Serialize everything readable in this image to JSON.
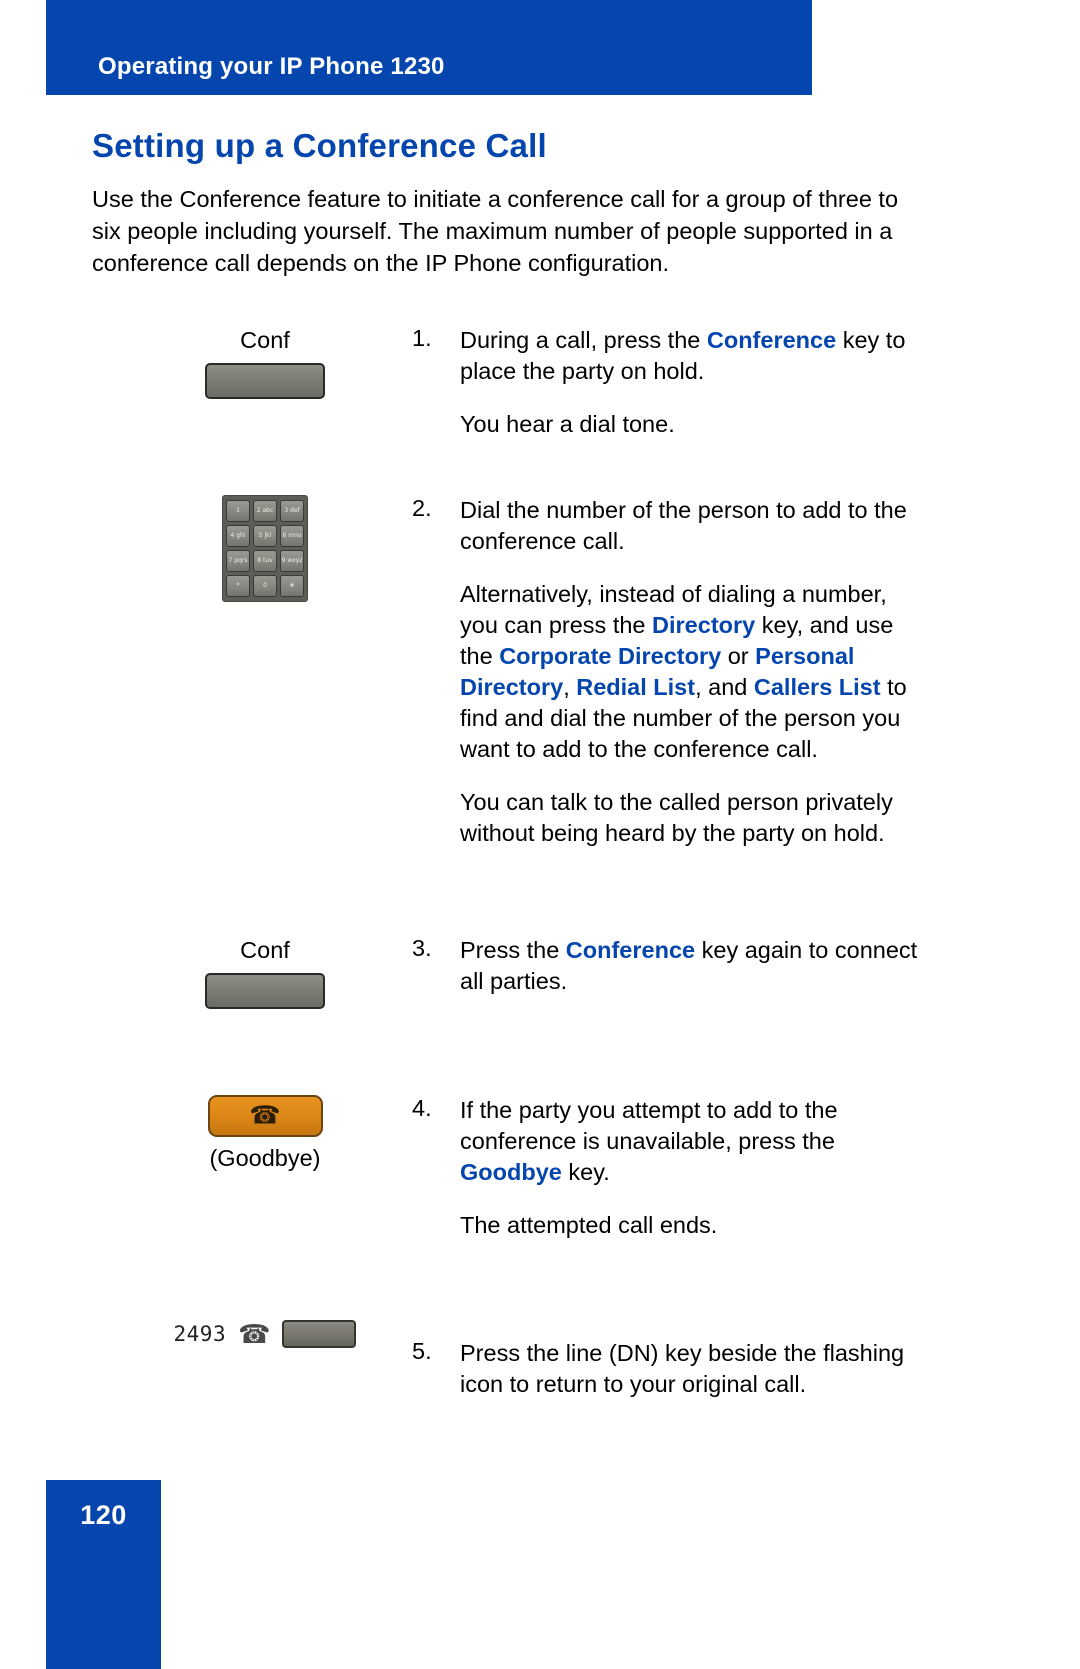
{
  "header": {
    "title": "Operating your IP Phone 1230",
    "bar_color": "#0546ae"
  },
  "page_title": "Setting up a Conference Call",
  "intro": "Use the Conference feature to initiate a conference call for a group of three to six people including yourself. The maximum number of people supported in a conference call depends on the IP Phone configuration.",
  "steps": [
    {
      "number": "1.",
      "art_label": "Conf",
      "art_type": "soft-key",
      "paragraphs": [
        {
          "runs": [
            {
              "text": "During a call, press the ",
              "style": "normal"
            },
            {
              "text": "Conference",
              "style": "keyword"
            },
            {
              "text": " key to place the party on hold.",
              "style": "normal"
            }
          ]
        },
        {
          "runs": [
            {
              "text": "You hear a dial tone.",
              "style": "normal"
            }
          ]
        }
      ]
    },
    {
      "number": "2.",
      "art_label": "",
      "art_type": "keypad",
      "keypad_keys": [
        "1",
        "2 abc",
        "3 def",
        "4 ghi",
        "5 jkl",
        "6 mno",
        "7 pqrs",
        "8 tuv",
        "9 wxyz",
        "*",
        "0",
        "#"
      ],
      "paragraphs": [
        {
          "runs": [
            {
              "text": "Dial the number of the person to add to the conference call.",
              "style": "normal"
            }
          ]
        },
        {
          "runs": [
            {
              "text": "Alternatively, instead of dialing a number, you can press the ",
              "style": "normal"
            },
            {
              "text": "Directory",
              "style": "keyword"
            },
            {
              "text": " key, and use the ",
              "style": "normal"
            },
            {
              "text": "Corporate Directory",
              "style": "keyword"
            },
            {
              "text": " or ",
              "style": "normal"
            },
            {
              "text": "Personal Directory",
              "style": "keyword"
            },
            {
              "text": ", ",
              "style": "normal"
            },
            {
              "text": "Redial List",
              "style": "keyword"
            },
            {
              "text": ", and ",
              "style": "normal"
            },
            {
              "text": "Callers List",
              "style": "keyword"
            },
            {
              "text": " to find and dial the number of the person you want to add to the conference call.",
              "style": "normal"
            }
          ]
        },
        {
          "runs": [
            {
              "text": "You can talk to the called person privately without being heard by the party on hold.",
              "style": "normal"
            }
          ]
        }
      ]
    },
    {
      "number": "3.",
      "art_label": "Conf",
      "art_type": "soft-key",
      "paragraphs": [
        {
          "runs": [
            {
              "text": "Press the ",
              "style": "normal"
            },
            {
              "text": "Conference",
              "style": "keyword"
            },
            {
              "text": " key again to connect all parties.",
              "style": "normal"
            }
          ]
        }
      ]
    },
    {
      "number": "4.",
      "art_label": "",
      "art_type": "goodbye-key",
      "art_caption": "(Goodbye)",
      "paragraphs": [
        {
          "runs": [
            {
              "text": "If the party you attempt to add to the conference is unavailable, press the ",
              "style": "normal"
            },
            {
              "text": "Goodbye",
              "style": "keyword"
            },
            {
              "text": " key.",
              "style": "normal"
            }
          ]
        },
        {
          "runs": [
            {
              "text": "The attempted call ends.",
              "style": "normal"
            }
          ]
        }
      ]
    },
    {
      "number": "5.",
      "art_label": "",
      "art_type": "line-key",
      "dn_number": "2493",
      "paragraphs": [
        {
          "runs": [
            {
              "text": "Press the line (DN) key beside the flashing icon to return to your original call.",
              "style": "normal"
            }
          ]
        }
      ]
    }
  ],
  "footer": {
    "page_number": "120",
    "bar_color": "#0546ae"
  },
  "colors": {
    "brand_blue": "#0546ae",
    "keyword_blue": "#0546ae",
    "goodbye_orange": "#dd8718",
    "key_gray": "#7e7d75"
  },
  "icons": {
    "handset": "☎",
    "phone_desk": "☎"
  }
}
